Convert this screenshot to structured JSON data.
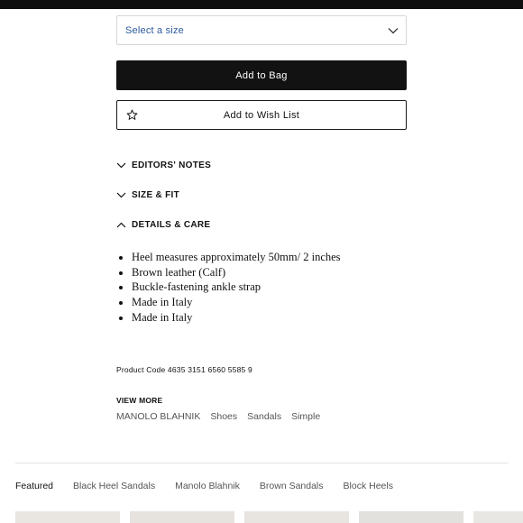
{
  "size_select": {
    "placeholder": "Select a size"
  },
  "buttons": {
    "add_to_bag": "Add to Bag",
    "add_to_wish_list": "Add to Wish List"
  },
  "accordion": [
    {
      "label": "EDITORS' NOTES",
      "expanded": false
    },
    {
      "label": "SIZE & FIT",
      "expanded": false
    },
    {
      "label": "DETAILS & CARE",
      "expanded": true
    }
  ],
  "details": [
    "Heel measures approximately 50mm/ 2 inches",
    "Brown leather (Calf)",
    "Buckle-fastening ankle strap",
    "Made in Italy",
    "Made in Italy"
  ],
  "product_code": "Product Code 4635 3151 6560 5585 9",
  "view_more": {
    "title": "VIEW MORE",
    "links": [
      "MANOLO BLAHNIK",
      "Shoes",
      "Sandals",
      "Simple"
    ]
  },
  "tabs": [
    "Featured",
    "Black Heel Sandals",
    "Manolo Blahnik",
    "Brown Sandals",
    "Block Heels"
  ],
  "colors": {
    "top_bar": "#0f0f0f",
    "primary_button": "#121212",
    "select_text": "#2c5a9c"
  }
}
